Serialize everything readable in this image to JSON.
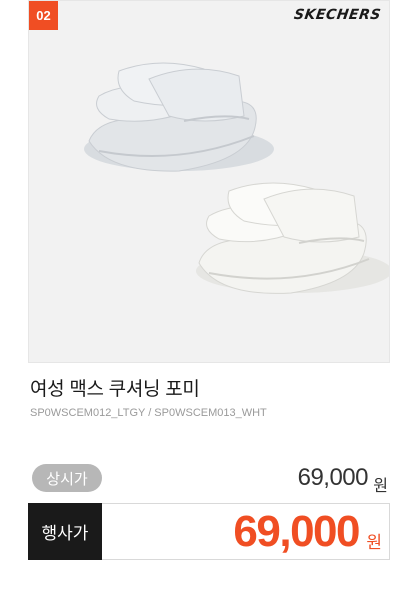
{
  "product": {
    "rank": "02",
    "brand": "SKECHERS",
    "name": "여성 맥스 쿠셔닝 포미",
    "code": "SP0WSCEM012_LTGY / SP0WSCEM013_WHT",
    "image_icon": "sandal-pair-image"
  },
  "pricing": {
    "normal_label": "상시가",
    "normal_price": "69,000",
    "normal_unit": "원",
    "event_label": "행사가",
    "event_price": "69,000",
    "event_unit": "원"
  },
  "colors": {
    "accent": "#f04e23",
    "badge_bg": "#f04e23",
    "event_label_bg": "#1a1a1a",
    "normal_label_bg": "#b7b7b7",
    "image_bg": "#f2f2f2"
  }
}
